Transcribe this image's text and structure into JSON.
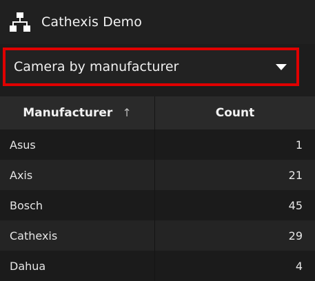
{
  "header": {
    "title": "Cathexis Demo",
    "icon": "network-tree-icon"
  },
  "dropdown": {
    "selected": "Camera by manufacturer",
    "highlight_color": "#e00000"
  },
  "table": {
    "columns": [
      "Manufacturer",
      "Count"
    ],
    "sort_indicator": "↑",
    "rows": [
      {
        "manufacturer": "Asus",
        "count": "1"
      },
      {
        "manufacturer": "Axis",
        "count": "21"
      },
      {
        "manufacturer": "Bosch",
        "count": "45"
      },
      {
        "manufacturer": "Cathexis",
        "count": "29"
      },
      {
        "manufacturer": "Dahua",
        "count": "4"
      }
    ]
  }
}
